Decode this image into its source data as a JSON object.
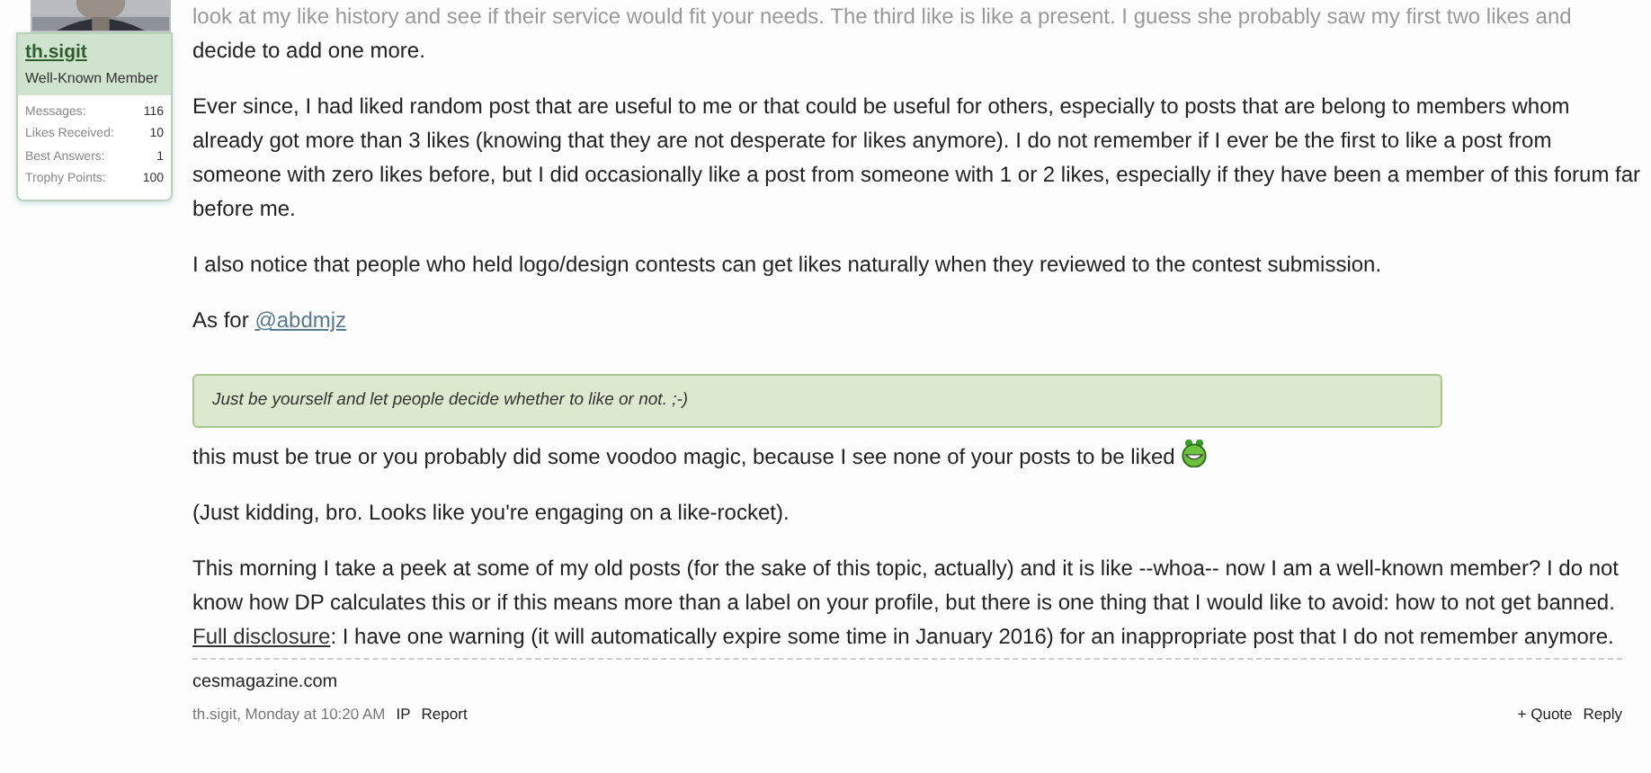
{
  "user": {
    "kind": "picture",
    "name": "th.sigit",
    "title": "Well-Known Member",
    "stats": [
      {
        "label": "Messages:",
        "value": "116"
      },
      {
        "label": "Likes Received:",
        "value": "10"
      },
      {
        "label": "Best Answers:",
        "value": "1"
      },
      {
        "label": "Trophy Points:",
        "value": "100"
      }
    ]
  },
  "post": {
    "blocks": [
      {
        "kind": "faded",
        "text": "look at my like history and see if their service would fit your needs. The third like is like a present. I guess she probably saw my first two likes and"
      },
      {
        "kind": "text",
        "text": "decide to add one more."
      },
      {
        "kind": "gap"
      },
      {
        "kind": "text",
        "text": "Ever since, I had liked random post that are useful to me or that could be useful for others, especially to posts that are belong to members whom already got more than 3 likes (knowing that they are not desperate for likes anymore). I do not remember if I ever be the first to like a post from someone with zero likes before, but I did occasionally like a post from someone with 1 or 2 likes, especially if they have been a member of this forum far before me."
      },
      {
        "kind": "gap"
      },
      {
        "kind": "text",
        "text": "I also notice that people who held logo/design contests can get likes naturally when they reviewed to the contest submission."
      },
      {
        "kind": "gap"
      },
      {
        "kind": "mention",
        "text": "As for ",
        "link": "@abdmjz"
      },
      {
        "kind": "gap"
      },
      {
        "kind": "quote",
        "text": "Just be yourself and let people decide whether to like or not. ;-)"
      },
      {
        "kind": "smiley",
        "text": "this must be true or you probably did some voodoo magic, because I see none of your posts to be liked"
      },
      {
        "kind": "gap"
      },
      {
        "kind": "text",
        "text": "(Just kidding, bro. Looks like you're engaging on a like-rocket)."
      },
      {
        "kind": "gap"
      },
      {
        "kind": "text",
        "text": "This morning I take a peek at some of my old posts (for the sake of this topic, actually) and it is like --whoa-- now I am a well-known member? I do not know how DP calculates this or if this means more than a label on your profile, but there is one thing that I would like to avoid: how to not get banned."
      },
      {
        "kind": "linked",
        "link": "Full disclosure",
        "text": ": I have one warning (it will automatically expire some time in January 2016) for an inappropriate post that I do not remember anymore."
      }
    ],
    "signature": "cesmagazine.com",
    "meta": "th.sigit, Monday at 10:20 AM",
    "actions_left": [
      "IP",
      "Report"
    ],
    "actions_right": [
      "+ Quote",
      "Reply"
    ]
  }
}
